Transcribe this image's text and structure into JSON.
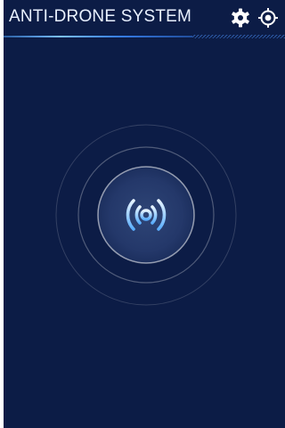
{
  "header": {
    "title": "ANTI-DRONE SYSTEM",
    "settings_icon": "gear-icon",
    "target_icon": "crosshair-target-icon"
  },
  "main": {
    "broadcast_icon": "signal-broadcast-icon"
  },
  "colors": {
    "background": "#0c1c46",
    "title_text": "#e9f1ff",
    "accent_blue": "#4da3ff",
    "icon_white": "#ffffff"
  }
}
